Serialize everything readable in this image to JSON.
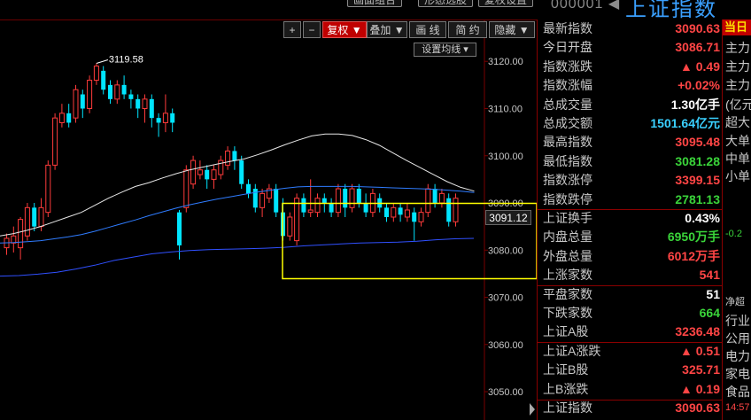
{
  "header": {
    "buttons": [
      "画面组合",
      "形态选股",
      "复权设置"
    ],
    "code": "000001",
    "name": "上证指数"
  },
  "toolbar": {
    "plus": "+",
    "minus": "−",
    "fuquan": "复权",
    "diejia": "叠加",
    "huaxian": "画 线",
    "jianyue": "简 约",
    "yincang": "隐藏",
    "ma_setting": "设置均线"
  },
  "chart_data": {
    "type": "candlestick",
    "ylim": [
      3044,
      3133
    ],
    "y_ticks": [
      "3120.00",
      "3110.00",
      "3100.00",
      "3090.00",
      "3080.00",
      "3070.00",
      "3060.00",
      "3050.00"
    ],
    "y_tick_values": [
      3120,
      3110,
      3100,
      3090,
      3080,
      3070,
      3060,
      3050
    ],
    "current_price": "3091.12",
    "high_marker": "3119.58",
    "high_marker_value": 3119.58,
    "candles": [
      {
        "o": 3080.5,
        "c": 3082.5,
        "h": 3083.5,
        "l": 3079
      },
      {
        "o": 3081.5,
        "c": 3083.0,
        "h": 3085,
        "l": 3079.5
      },
      {
        "o": 3080.5,
        "c": 3086.5,
        "h": 3087,
        "l": 3078
      },
      {
        "o": 3083,
        "c": 3089,
        "h": 3090,
        "l": 3082
      },
      {
        "o": 3089,
        "c": 3085,
        "h": 3090,
        "l": 3084
      },
      {
        "o": 3085,
        "c": 3089,
        "h": 3091,
        "l": 3084
      },
      {
        "o": 3088,
        "c": 3098,
        "h": 3099,
        "l": 3087
      },
      {
        "o": 3098,
        "c": 3108,
        "h": 3109,
        "l": 3097
      },
      {
        "o": 3107,
        "c": 3109,
        "h": 3111,
        "l": 3106
      },
      {
        "o": 3109,
        "c": 3107,
        "h": 3111,
        "l": 3106
      },
      {
        "o": 3108,
        "c": 3114,
        "h": 3115,
        "l": 3107
      },
      {
        "o": 3113,
        "c": 3110,
        "h": 3114,
        "l": 3108
      },
      {
        "o": 3110,
        "c": 3116,
        "h": 3117,
        "l": 3109
      },
      {
        "o": 3116,
        "c": 3119,
        "h": 3119.58,
        "l": 3115
      },
      {
        "o": 3118,
        "c": 3114,
        "h": 3119,
        "l": 3113
      },
      {
        "o": 3115,
        "c": 3112,
        "h": 3116,
        "l": 3111
      },
      {
        "o": 3112,
        "c": 3115,
        "h": 3116,
        "l": 3111
      },
      {
        "o": 3115,
        "c": 3113,
        "h": 3117,
        "l": 3112
      },
      {
        "o": 3113,
        "c": 3112,
        "h": 3114,
        "l": 3110
      },
      {
        "o": 3112,
        "c": 3110,
        "h": 3113,
        "l": 3108
      },
      {
        "o": 3110,
        "c": 3112,
        "h": 3113,
        "l": 3107
      },
      {
        "o": 3112,
        "c": 3108,
        "h": 3113,
        "l": 3106
      },
      {
        "o": 3108,
        "c": 3107,
        "h": 3109,
        "l": 3104
      },
      {
        "o": 3107,
        "c": 3109,
        "h": 3113,
        "l": 3105
      },
      {
        "o": 3109,
        "c": 3107,
        "h": 3110,
        "l": 3105
      },
      {
        "o": 3088,
        "c": 3081,
        "h": 3088.5,
        "l": 3078
      },
      {
        "o": 3089,
        "c": 3097,
        "h": 3098,
        "l": 3088
      },
      {
        "o": 3094,
        "c": 3099,
        "h": 3100,
        "l": 3093
      },
      {
        "o": 3096,
        "c": 3097,
        "h": 3099,
        "l": 3095
      },
      {
        "o": 3097,
        "c": 3095,
        "h": 3098,
        "l": 3093
      },
      {
        "o": 3095,
        "c": 3097,
        "h": 3098,
        "l": 3093
      },
      {
        "o": 3096,
        "c": 3099,
        "h": 3100,
        "l": 3095
      },
      {
        "o": 3098,
        "c": 3101,
        "h": 3102,
        "l": 3097
      },
      {
        "o": 3101,
        "c": 3099,
        "h": 3102,
        "l": 3097
      },
      {
        "o": 3099,
        "c": 3094,
        "h": 3100,
        "l": 3093
      },
      {
        "o": 3094,
        "c": 3092,
        "h": 3095,
        "l": 3091
      },
      {
        "o": 3093,
        "c": 3089,
        "h": 3094,
        "l": 3088
      },
      {
        "o": 3089,
        "c": 3092,
        "h": 3093,
        "l": 3087
      },
      {
        "o": 3091,
        "c": 3093,
        "h": 3094,
        "l": 3090
      },
      {
        "o": 3093,
        "c": 3088,
        "h": 3094,
        "l": 3087
      },
      {
        "o": 3088,
        "c": 3083,
        "h": 3091,
        "l": 3082
      },
      {
        "o": 3083,
        "c": 3087,
        "h": 3088,
        "l": 3082
      },
      {
        "o": 3082,
        "c": 3091,
        "h": 3092,
        "l": 3081
      },
      {
        "o": 3091,
        "c": 3088,
        "h": 3092,
        "l": 3087
      },
      {
        "o": 3088,
        "c": 3088.5,
        "h": 3095,
        "l": 3087
      },
      {
        "o": 3088,
        "c": 3091,
        "h": 3092,
        "l": 3087
      },
      {
        "o": 3091,
        "c": 3090,
        "h": 3092,
        "l": 3088
      },
      {
        "o": 3090,
        "c": 3088,
        "h": 3091,
        "l": 3087
      },
      {
        "o": 3088,
        "c": 3093,
        "h": 3094,
        "l": 3087
      },
      {
        "o": 3093,
        "c": 3089,
        "h": 3094,
        "l": 3087
      },
      {
        "o": 3089,
        "c": 3093,
        "h": 3094,
        "l": 3088
      },
      {
        "o": 3093,
        "c": 3090,
        "h": 3094,
        "l": 3089
      },
      {
        "o": 3090,
        "c": 3088,
        "h": 3092,
        "l": 3087
      },
      {
        "o": 3088,
        "c": 3092,
        "h": 3093,
        "l": 3087
      },
      {
        "o": 3091,
        "c": 3089,
        "h": 3092,
        "l": 3088
      },
      {
        "o": 3089,
        "c": 3087,
        "h": 3090,
        "l": 3086
      },
      {
        "o": 3087,
        "c": 3089,
        "h": 3090,
        "l": 3086
      },
      {
        "o": 3089,
        "c": 3087.5,
        "h": 3090,
        "l": 3086
      },
      {
        "o": 3087,
        "c": 3088.5,
        "h": 3090,
        "l": 3086
      },
      {
        "o": 3088,
        "c": 3086,
        "h": 3089,
        "l": 3082
      },
      {
        "o": 3086,
        "c": 3088,
        "h": 3089,
        "l": 3085
      },
      {
        "o": 3088,
        "c": 3093,
        "h": 3094,
        "l": 3087
      },
      {
        "o": 3093,
        "c": 3090,
        "h": 3094,
        "l": 3089
      },
      {
        "o": 3090,
        "c": 3092,
        "h": 3093,
        "l": 3089
      },
      {
        "o": 3091,
        "c": 3086,
        "h": 3092,
        "l": 3085
      },
      {
        "o": 3086,
        "c": 3091,
        "h": 3092,
        "l": 3085
      }
    ],
    "ma_white": [
      3083,
      3083.5,
      3084.2,
      3085,
      3086,
      3087,
      3088,
      3089.5,
      3091,
      3092.3,
      3093.5,
      3094.3,
      3095.3,
      3096.2,
      3097,
      3097.6,
      3098.2,
      3098.8,
      3099.3,
      3100.2,
      3101.2,
      3102.3,
      3103.3,
      3104.2,
      3104.6,
      3104.6,
      3104.3,
      3103.4,
      3102.2,
      3100.6,
      3099,
      3097.5,
      3096,
      3094.5,
      3093.3,
      3092.5
    ],
    "ma_blue": [
      3081.5,
      3081.6,
      3081.8,
      3082,
      3082.4,
      3082.8,
      3083.3,
      3084,
      3084.8,
      3085.6,
      3086.4,
      3087.3,
      3088.1,
      3088.9,
      3089.6,
      3090.2,
      3090.8,
      3091.3,
      3091.8,
      3092.3,
      3092.7,
      3093.1,
      3093.4,
      3093.5,
      3093.5,
      3093.5,
      3093.5,
      3093.4,
      3093.3,
      3093.2,
      3093.1,
      3093,
      3092.9,
      3092.7,
      3092.5,
      3092.2
    ],
    "ma_dark": [
      3074.5,
      3074.6,
      3074.9,
      3075.3,
      3076,
      3076.8,
      3077.8,
      3078.5,
      3079.2,
      3079.6,
      3079.9,
      3080.1,
      3080.2,
      3080.3,
      3080.4,
      3080.6,
      3080.9,
      3081.1,
      3081.3,
      3081.5,
      3081.6,
      3081.7,
      3081.9,
      3082.2,
      3082.4,
      3082.5
    ]
  },
  "panel": {
    "rows": [
      {
        "label": "最新指数",
        "value": "3090.63",
        "color": "red"
      },
      {
        "label": "今日开盘",
        "value": "3086.71",
        "color": "red"
      },
      {
        "label": "指数涨跌",
        "value": "▲ 0.49",
        "color": "red"
      },
      {
        "label": "指数涨幅",
        "value": "+0.02%",
        "color": "red"
      },
      {
        "label": "总成交量",
        "value": "1.30亿手",
        "color": "white"
      },
      {
        "label": "总成交额",
        "value": "1501.64亿元",
        "color": "cyan"
      },
      {
        "label": "最高指数",
        "value": "3095.48",
        "color": "red"
      },
      {
        "label": "最低指数",
        "value": "3081.28",
        "color": "green"
      },
      {
        "label": "指数涨停",
        "value": "3399.15",
        "color": "red"
      },
      {
        "label": "指数跌停",
        "value": "2781.13",
        "color": "green"
      },
      {
        "label": "上证换手",
        "value": "0.43%",
        "color": "white"
      },
      {
        "label": "内盘总量",
        "value": "6950万手",
        "color": "green"
      },
      {
        "label": "外盘总量",
        "value": "6012万手",
        "color": "red"
      },
      {
        "label": "上涨家数",
        "value": "541",
        "color": "red"
      },
      {
        "label": "平盘家数",
        "value": "51",
        "color": "white"
      },
      {
        "label": "下跌家数",
        "value": "664",
        "color": "green"
      },
      {
        "label": "上证A股",
        "value": "3236.48",
        "color": "red"
      },
      {
        "label": "上证A涨跌",
        "value": "▲ 0.51",
        "color": "red"
      },
      {
        "label": "上证B股",
        "value": "325.71",
        "color": "red"
      },
      {
        "label": "上B涨跌",
        "value": "▲ 0.19",
        "color": "red"
      },
      {
        "label": "上证指数",
        "value": "3090.63",
        "color": "red"
      }
    ]
  },
  "sidebar": {
    "head": "当日",
    "items": [
      "主力",
      "主力",
      "主力",
      "(亿元",
      "超大",
      "大单",
      "中单",
      "小单",
      "-0.2",
      "净超",
      "行业",
      "公用",
      "电力",
      "家电",
      "食品",
      "14:57"
    ]
  }
}
